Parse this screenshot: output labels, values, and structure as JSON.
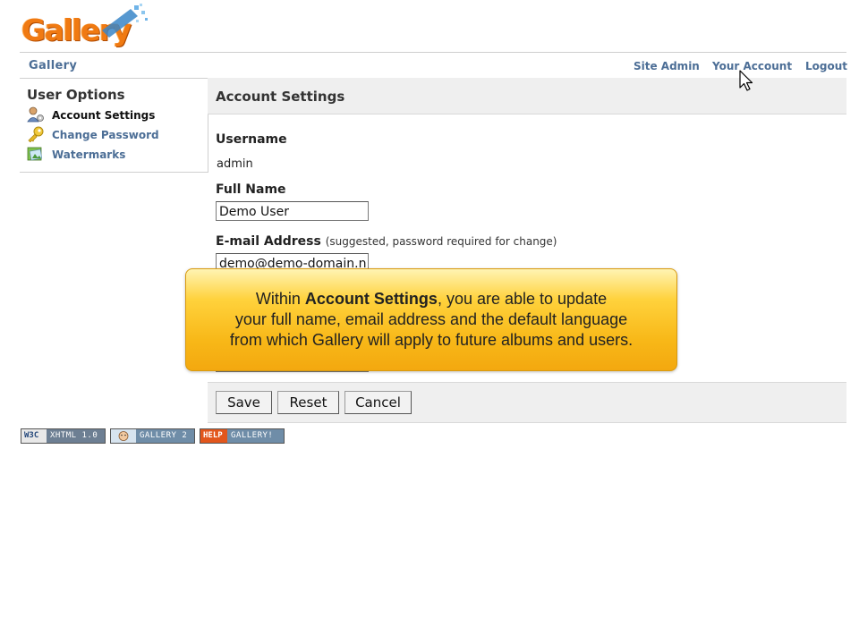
{
  "logo": {
    "text": "Gallery"
  },
  "nav": {
    "brand": "Gallery",
    "site_admin": "Site Admin",
    "your_account": "Your Account",
    "logout": "Logout"
  },
  "sidebar": {
    "title": "User Options",
    "items": [
      {
        "label": "Account Settings",
        "icon": "user-settings-icon",
        "active": true
      },
      {
        "label": "Change Password",
        "icon": "key-icon",
        "active": false
      },
      {
        "label": "Watermarks",
        "icon": "watermark-icon",
        "active": false
      }
    ]
  },
  "main": {
    "title": "Account Settings",
    "username_label": "Username",
    "username_value": "admin",
    "fullname_label": "Full Name",
    "fullname_value": "Demo User",
    "email_label": "E-mail Address",
    "email_hint": "(suggested, password required for change)",
    "email_value": "demo@demo-domain.n"
  },
  "tooltip": {
    "prefix": "Within ",
    "bold": "Account Settings",
    "line1_rest": ", you are able to update",
    "line2": "your full name, email address and the default language",
    "line3": "from which Gallery will apply to future albums and users."
  },
  "buttons": {
    "save": "Save",
    "reset": "Reset",
    "cancel": "Cancel"
  },
  "footer": {
    "badge_xhtml_left": "W3C",
    "badge_xhtml_right": "XHTML 1.0",
    "badge_gallery_right": "GALLERY 2",
    "badge_help_left": "HELP",
    "badge_help_right": "GALLERY!"
  },
  "colors": {
    "link": "#4c6e96",
    "logo_orange": "#f07a12",
    "tooltip_yellow": "#f8b818"
  }
}
